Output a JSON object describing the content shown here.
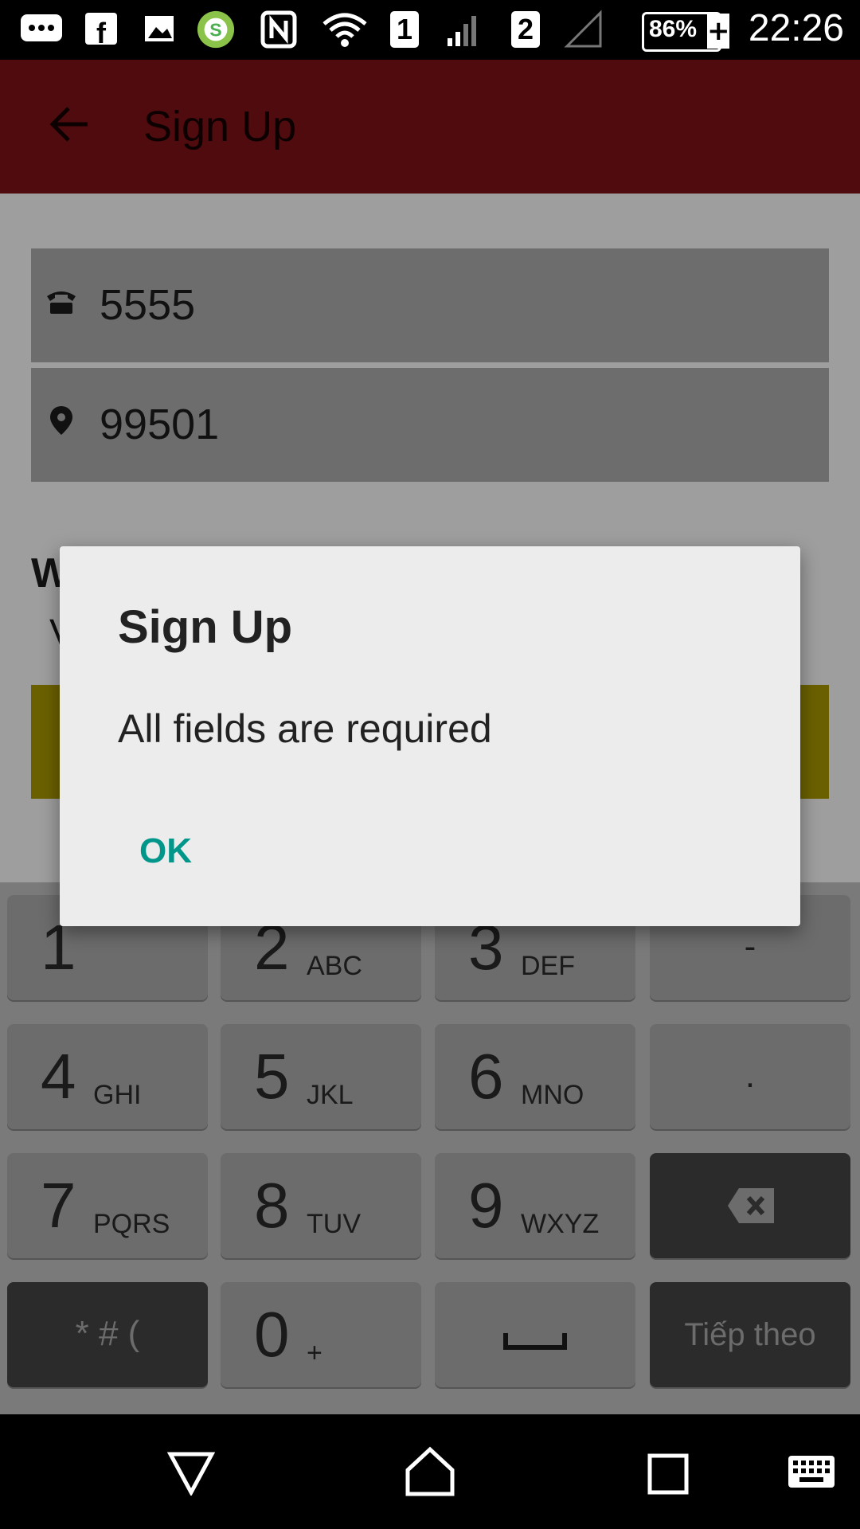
{
  "status_bar": {
    "time": "22:26",
    "battery": "86%",
    "sim1": "1",
    "sim2": "2"
  },
  "app_bar": {
    "title": "Sign Up"
  },
  "form": {
    "phone_value": "5555",
    "zip_value": "99501"
  },
  "dialog": {
    "title": "Sign Up",
    "message": "All fields are required",
    "ok_label": "OK"
  },
  "keypad": {
    "rows": [
      [
        {
          "num": "1",
          "sub": ""
        },
        {
          "num": "2",
          "sub": "ABC"
        },
        {
          "num": "3",
          "sub": "DEF"
        },
        {
          "num": "",
          "sub": "-"
        }
      ],
      [
        {
          "num": "4",
          "sub": "GHI"
        },
        {
          "num": "5",
          "sub": "JKL"
        },
        {
          "num": "6",
          "sub": "MNO"
        },
        {
          "num": "",
          "sub": "."
        }
      ],
      [
        {
          "num": "7",
          "sub": "PQRS"
        },
        {
          "num": "8",
          "sub": "TUV"
        },
        {
          "num": "9",
          "sub": "WXYZ"
        },
        {
          "num": "",
          "sub": ""
        }
      ],
      [
        {
          "num": "",
          "sub": "* # ("
        },
        {
          "num": "0",
          "sub": "+"
        },
        {
          "num": "",
          "sub": ""
        },
        {
          "num": "",
          "sub": "Tiếp theo"
        }
      ]
    ]
  },
  "colors": {
    "app_bar": "#500b0f",
    "accent": "#00968a",
    "dialog_bg": "#ececec"
  }
}
